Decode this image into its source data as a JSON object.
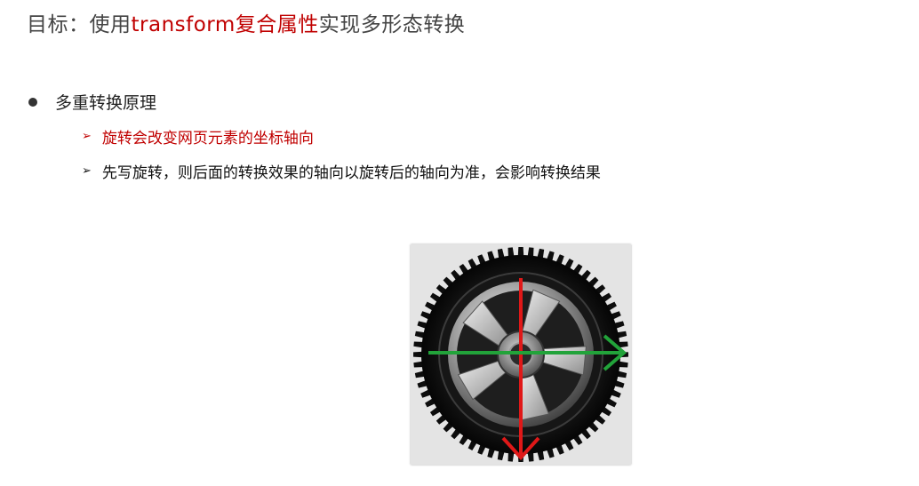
{
  "title": {
    "prefix": "目标：使用",
    "highlight": "transform复合属性",
    "suffix": "实现多形态转换"
  },
  "main_point": {
    "label": "多重转换原理"
  },
  "sub_points": [
    {
      "text": "旋转会改变网页元素的坐标轴向",
      "color": "#c00000"
    },
    {
      "text": "先写旋转，则后面的转换效果的轴向以旋转后的轴向为准，会影响转换结果",
      "color": "#111111"
    }
  ],
  "illustration": {
    "icon": "wheel-with-axes",
    "x_axis_color": "#22a33a",
    "y_axis_color": "#e01818"
  }
}
